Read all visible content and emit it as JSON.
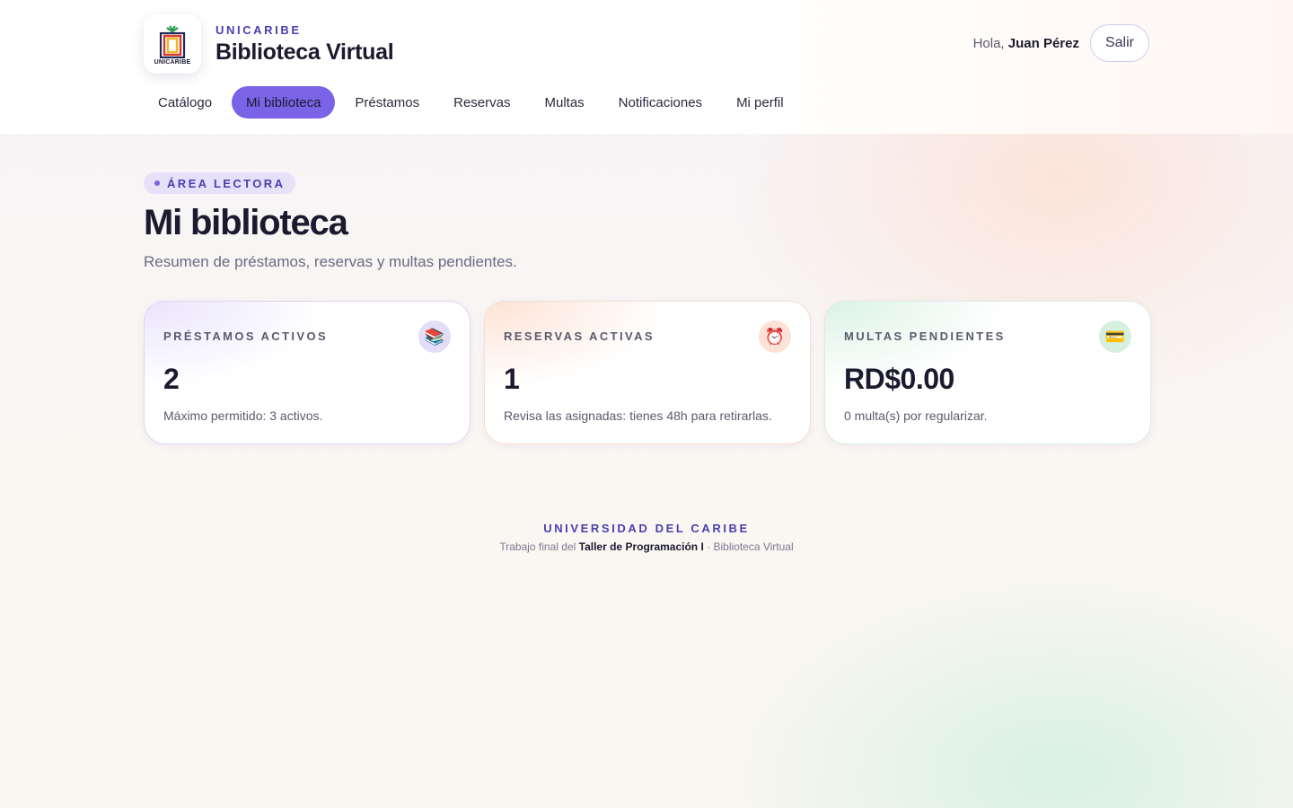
{
  "brand": {
    "logo_caption": "UNICARIBE",
    "kicker": "UNICARIBE",
    "title": "Biblioteca Virtual"
  },
  "user": {
    "greeting_prefix": "Hola,",
    "name": "Juan Pérez",
    "logout_label": "Salir"
  },
  "nav": {
    "items": [
      {
        "label": "Catálogo",
        "active": false
      },
      {
        "label": "Mi biblioteca",
        "active": true
      },
      {
        "label": "Préstamos",
        "active": false
      },
      {
        "label": "Reservas",
        "active": false
      },
      {
        "label": "Multas",
        "active": false
      },
      {
        "label": "Notificaciones",
        "active": false
      },
      {
        "label": "Mi perfil",
        "active": false
      }
    ]
  },
  "main": {
    "section_pill": "ÁREA LECTORA",
    "title": "Mi biblioteca",
    "subtitle": "Resumen de préstamos, reservas y multas pendientes.",
    "cards": [
      {
        "label": "PRÉSTAMOS ACTIVOS",
        "icon": "books-icon",
        "glyph": "📚",
        "value": "2",
        "note": "Máximo permitido: 3 activos."
      },
      {
        "label": "RESERVAS ACTIVAS",
        "icon": "alarm-clock-icon",
        "glyph": "⏰",
        "value": "1",
        "note": "Revisa las asignadas: tienes 48h para retirarlas."
      },
      {
        "label": "MULTAS PENDIENTES",
        "icon": "credit-card-icon",
        "glyph": "💳",
        "value": "RD$0.00",
        "note": "0 multa(s) por regularizar."
      }
    ]
  },
  "footer": {
    "kicker": "UNIVERSIDAD DEL CARIBE",
    "prefix": "Trabajo final del",
    "course": "Taller de Programación I",
    "suffix": "· Biblioteca Virtual"
  },
  "colors": {
    "accent": "#7a63e6",
    "accent_dark": "#4a3fb0",
    "text": "#1b1a2e"
  }
}
